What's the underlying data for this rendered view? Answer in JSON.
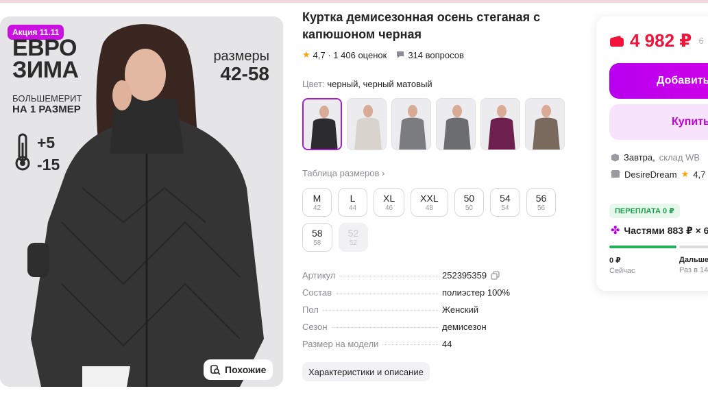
{
  "photo": {
    "promo_badge": "Акция 11.11",
    "headline_1": "ЕВРО",
    "headline_2": "ЗИМА",
    "bigger_1": "БОЛЬШЕМЕРИТ",
    "bigger_2": "НА 1 РАЗМЕР",
    "temp_plus": "+5",
    "temp_minus": "-15",
    "sizes_label": "размеры",
    "sizes_range": "42-58",
    "similar_label": "Похожие"
  },
  "product": {
    "title": "Куртка демисезонная осень стеганая с капюшоном черная",
    "rating": "4,7",
    "reviews": "· 1 406 оценок",
    "questions": "314 вопросов",
    "color_label": "Цвет:",
    "color_value": "черный, черный матовый",
    "swatch_colors": [
      "#2c2c2e",
      "#d8d3cc",
      "#7b7c7f",
      "#6c6d6e",
      "#6d1f4d",
      "#7a6a5e"
    ],
    "size_table_link": "Таблица размеров ›",
    "sizes": [
      {
        "label": "M",
        "ru": "42"
      },
      {
        "label": "L",
        "ru": "44"
      },
      {
        "label": "XL",
        "ru": "46"
      },
      {
        "label": "XXL",
        "ru": "48"
      },
      {
        "label": "50",
        "ru": "50"
      },
      {
        "label": "54",
        "ru": "54"
      },
      {
        "label": "56",
        "ru": "56"
      },
      {
        "label": "58",
        "ru": "58"
      },
      {
        "label": "52",
        "ru": "52"
      }
    ],
    "specs": [
      {
        "key": "Артикул",
        "value": "252395359"
      },
      {
        "key": "Состав",
        "value": "полиэстер 100%"
      },
      {
        "key": "Пол",
        "value": "Женский"
      },
      {
        "key": "Сезон",
        "value": "демисезон"
      },
      {
        "key": "Размер на модели",
        "value": "44"
      }
    ],
    "chars_button": "Характеристики и описание"
  },
  "buybox": {
    "price": "4 982 ₽",
    "old_price": "6",
    "add_to_cart": "Добавить",
    "buy_now": "Купить",
    "delivery_day": "Завтра,",
    "delivery_place": "склад WB",
    "seller_name": "DesireDream",
    "seller_rating": "4,7",
    "overpay": "ПЕРЕПЛАТА 0 ₽",
    "installments": "Частями 883 ₽ × 6",
    "pay_now_value": "0 ₽",
    "pay_now_label": "Сейчас",
    "pay_later_value": "Дальше",
    "pay_later_label": "Раз в 14"
  }
}
